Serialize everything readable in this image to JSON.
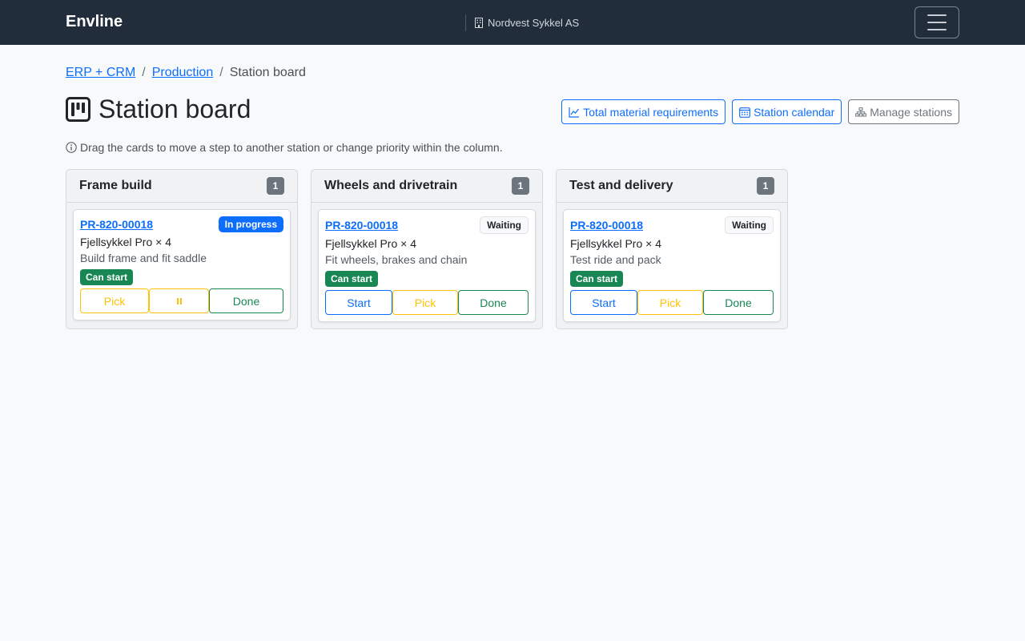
{
  "navbar": {
    "brand": "Envline",
    "company": "Nordvest Sykkel AS"
  },
  "breadcrumb": [
    {
      "label": "ERP + CRM"
    },
    {
      "label": "Production"
    },
    {
      "label": "Station board"
    }
  ],
  "page": {
    "title": "Station board",
    "hint": "Drag the cards to move a step to another station or change priority within the column."
  },
  "actions": {
    "material": "Total material requirements",
    "calendar": "Station calendar",
    "manage": "Manage stations"
  },
  "columns": [
    {
      "title": "Frame build",
      "count": "1",
      "card": {
        "order": "PR-820-00018",
        "status": "In progress",
        "product": "Fjellsykkel Pro × 4",
        "step": "Build frame and fit saddle",
        "badge": "Can start",
        "buttons": {
          "pick": "Pick",
          "done": "Done"
        }
      }
    },
    {
      "title": "Wheels and drivetrain",
      "count": "1",
      "card": {
        "order": "PR-820-00018",
        "status": "Waiting",
        "product": "Fjellsykkel Pro × 4",
        "step": "Fit wheels, brakes and chain",
        "badge": "Can start",
        "buttons": {
          "start": "Start",
          "pick": "Pick",
          "done": "Done"
        }
      }
    },
    {
      "title": "Test and delivery",
      "count": "1",
      "card": {
        "order": "PR-820-00018",
        "status": "Waiting",
        "product": "Fjellsykkel Pro × 4",
        "step": "Test ride and pack",
        "badge": "Can start",
        "buttons": {
          "start": "Start",
          "pick": "Pick",
          "done": "Done"
        }
      }
    }
  ],
  "icons": {
    "company": "building-icon",
    "menu": "hamburger-icon",
    "title": "kanban-icon",
    "material": "graph-up-icon",
    "calendar": "calendar-icon",
    "manage": "diagram-icon",
    "hint": "info-circle-icon",
    "pause": "pause-icon"
  },
  "colors": {
    "navbar": "#212d3b",
    "primary": "#0d6efd",
    "success": "#198754",
    "warning": "#ffc107",
    "secondary": "#6c757d"
  }
}
